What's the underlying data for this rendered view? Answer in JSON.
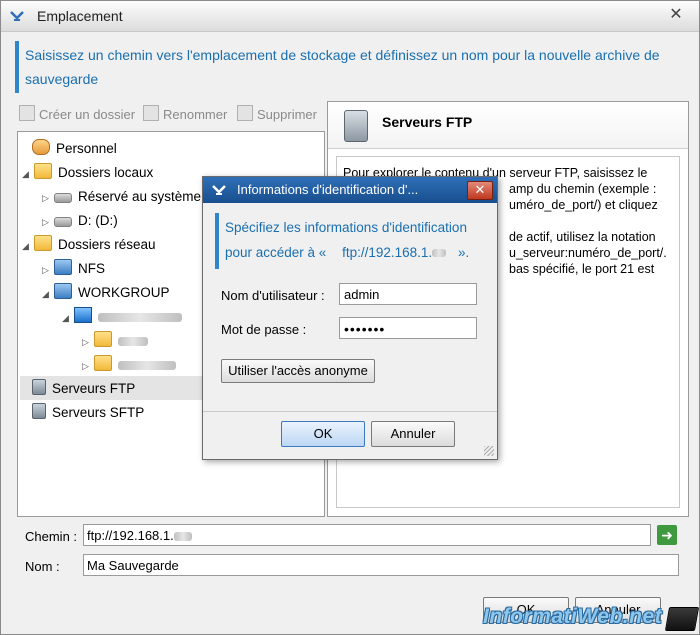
{
  "window": {
    "title": "Emplacement",
    "header_text": "Saisissez un chemin vers l'emplacement de stockage et définissez un nom pour la nouvelle archive de sauvegarde"
  },
  "toolbar": {
    "create_folder": "Créer un dossier",
    "rename": "Renommer",
    "delete": "Supprimer"
  },
  "tree": {
    "items": [
      {
        "label": "Personnel"
      },
      {
        "label": "Dossiers locaux"
      },
      {
        "label": "Réservé au système"
      },
      {
        "label": "D: (D:)"
      },
      {
        "label": "Dossiers réseau"
      },
      {
        "label": "NFS"
      },
      {
        "label": "WORKGROUP"
      },
      {
        "label": "Serveurs FTP"
      },
      {
        "label": "Serveurs SFTP"
      }
    ]
  },
  "panel": {
    "title": "Serveurs FTP",
    "line1": "Pour explorer le contenu d'un serveur FTP, saisissez le",
    "line2": "amp du chemin (exemple :",
    "line3": "uméro_de_port/) et cliquez",
    "line4": "de actif, utilisez la notation",
    "line5": "u_serveur:numéro_de_port/.",
    "line6": "bas spécifié, le port 21 est"
  },
  "path": {
    "label": "Chemin :",
    "value": "ftp://192.168.1."
  },
  "name": {
    "label": "Nom :",
    "value": "Ma Sauvegarde"
  },
  "footer": {
    "ok": "OK",
    "cancel": "Annuler"
  },
  "watermark": "InformatiWeb.net",
  "dialog": {
    "title": "Informations d'identification d'...",
    "band_line1": "Spécifiez les informations d'identification",
    "band_line2_prefix": "pour accéder à «",
    "band_line2_url": "ftp://192.168.1.",
    "band_line2_suffix": "».",
    "username_label": "Nom d'utilisateur :",
    "username_value": "admin",
    "password_label": "Mot de passe :",
    "password_value": "•••••••",
    "anonymous_button": "Utiliser l'accès anonyme",
    "ok": "OK",
    "cancel": "Annuler"
  }
}
